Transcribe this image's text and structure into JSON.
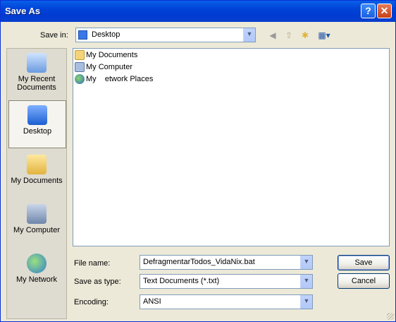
{
  "window": {
    "title": "Save As",
    "help_glyph": "?",
    "close_glyph": "✕"
  },
  "toolbar": {
    "save_in_label": "Save in:",
    "save_in_value": "Desktop",
    "back_icon": "back-icon",
    "up_icon": "up-folder-icon",
    "new_folder_icon": "new-folder-icon",
    "views_icon": "views-menu-icon"
  },
  "places": [
    {
      "label": "My Recent Documents",
      "icon": "recent-documents-icon"
    },
    {
      "label": "Desktop",
      "icon": "desktop-icon",
      "selected": true
    },
    {
      "label": "My Documents",
      "icon": "my-documents-icon"
    },
    {
      "label": "My Computer",
      "icon": "my-computer-icon"
    },
    {
      "label": "My Network",
      "icon": "my-network-icon"
    }
  ],
  "files": [
    {
      "label": "My Documents",
      "icon": "folder-documents-icon"
    },
    {
      "label": "My Computer",
      "icon": "computer-icon"
    },
    {
      "label": "My    etwork Places",
      "icon": "network-places-icon"
    }
  ],
  "form": {
    "file_name_label": "File name:",
    "file_name_value": "DefragmentarTodos_VidaNix.bat",
    "save_as_type_label": "Save as type:",
    "save_as_type_value": "Text Documents (*.txt)",
    "encoding_label": "Encoding:",
    "encoding_value": "ANSI"
  },
  "buttons": {
    "save": "Save",
    "cancel": "Cancel"
  },
  "colors": {
    "titlebar": "#0043d6",
    "dialog_bg": "#ece9d8"
  }
}
